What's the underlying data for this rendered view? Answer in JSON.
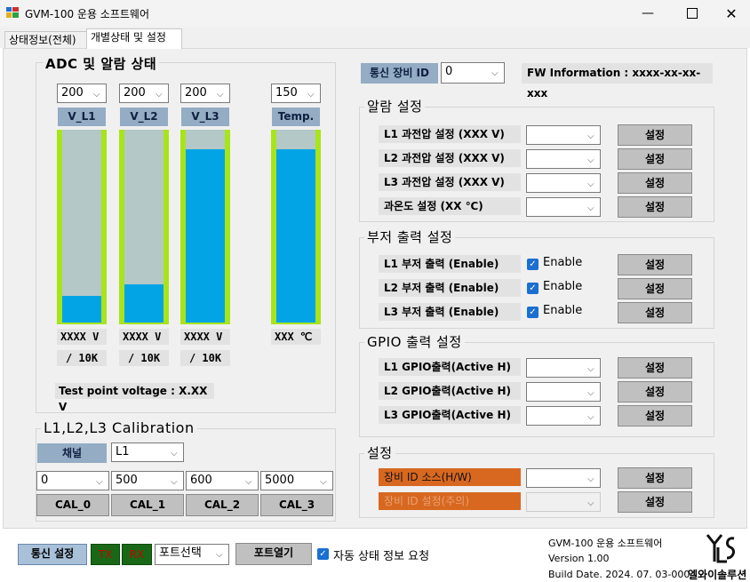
{
  "window": {
    "title": "GVM-100 운용 소프트웨어"
  },
  "tabs": [
    {
      "label": "상태정보(전체)"
    },
    {
      "label": "개별상태 및 설정"
    }
  ],
  "adc": {
    "title": "ADC 및 알람 상태",
    "channels": [
      {
        "select": "200",
        "label": "V_L1",
        "value": "XXXX V",
        "sub": "/ 10K",
        "level": 0.14
      },
      {
        "select": "200",
        "label": "V_L2",
        "value": "XXXX V",
        "sub": "/ 10K",
        "level": 0.2
      },
      {
        "select": "200",
        "label": "V_L3",
        "value": "XXXX V",
        "sub": "/ 10K",
        "level": 0.9
      }
    ],
    "temp": {
      "select": "150",
      "label": "Temp.",
      "value": "XXX ℃",
      "level": 0.9
    },
    "test_point": "Test point voltage : X.XX V"
  },
  "calibration": {
    "title": "L1,L2,L3 Calibration",
    "channel_label": "채널",
    "channel_value": "L1",
    "values": [
      "0",
      "500",
      "600",
      "5000"
    ],
    "buttons": [
      "CAL_0",
      "CAL_1",
      "CAL_2",
      "CAL_3"
    ]
  },
  "comm": {
    "id_label": "통신 장비 ID",
    "id_value": "0",
    "fw_info": "FW Information : xxxx-xx-xx-xxx"
  },
  "alarm": {
    "title": "알람 설정",
    "rows": [
      {
        "label": "L1 과전압 설정 (XXX V)"
      },
      {
        "label": "L2 과전압 설정 (XXX V)"
      },
      {
        "label": "L3 과전압 설정 (XXX V)"
      },
      {
        "label": "과온도 설정 (XX ℃)"
      }
    ]
  },
  "buzzer": {
    "title": "부저 출력 설정",
    "rows": [
      {
        "label": "L1 부저 출력 (Enable)",
        "check": "Enable"
      },
      {
        "label": "L2 부저 출력 (Enable)",
        "check": "Enable"
      },
      {
        "label": "L3 부저 출력 (Enable)",
        "check": "Enable"
      }
    ]
  },
  "gpio": {
    "title": "GPIO 출력 설정",
    "rows": [
      {
        "label": "L1 GPIO출력(Active H)"
      },
      {
        "label": "L2 GPIO출력(Active H)"
      },
      {
        "label": "L3 GPIO출력(Active H)"
      }
    ]
  },
  "settings": {
    "title": "설정",
    "rows": [
      {
        "label": "장비 ID 소스(H/W)"
      },
      {
        "label": "장비 ID 설정(주의)"
      }
    ]
  },
  "set_label": "설정",
  "footer": {
    "comm_settings": "통신 설정",
    "tx": "TX",
    "rx": "RX",
    "port_select": "포트선택",
    "port_open": "포트열기",
    "auto_request": "자동 상태 정보 요청",
    "app_name": "GVM-100 운용 소프트웨어",
    "version": "Version 1.00",
    "build_date": "Build Date. 2024. 07. 03-000",
    "company": "엘와이솔루션"
  },
  "colors": {
    "bar_border": "#a8e41a",
    "bar_fill": "#03a4e6",
    "bar_empty": "#b4c8c8",
    "chip": "#94acc4",
    "orange": "#d86820"
  }
}
